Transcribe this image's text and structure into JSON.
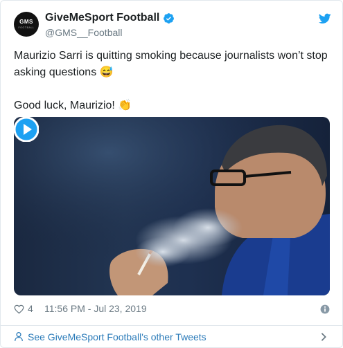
{
  "tweet": {
    "author": {
      "name": "GiveMeSport Football",
      "handle": "@GMS__Football",
      "avatar_text": "GMS",
      "avatar_subtext": "FOOTBALL",
      "verified": true
    },
    "text_line1": "Maurizio Sarri is quitting smoking because journalists won’t stop asking questions 😅",
    "text_line2": "Good luck, Maurizio! 👏",
    "media": {
      "type": "video",
      "play_icon": "play-icon"
    },
    "likes": "4",
    "timestamp": "11:56 PM - Jul 23, 2019"
  },
  "footer": {
    "label": "See GiveMeSport Football's other Tweets"
  },
  "colors": {
    "brand_blue": "#1da1f2",
    "link_blue": "#2b7bb9",
    "muted": "#697882",
    "text": "#1c2022"
  },
  "icons": [
    "verified-badge-icon",
    "twitter-bird-icon",
    "heart-icon",
    "info-icon",
    "person-icon",
    "chevron-right-icon",
    "play-icon"
  ]
}
